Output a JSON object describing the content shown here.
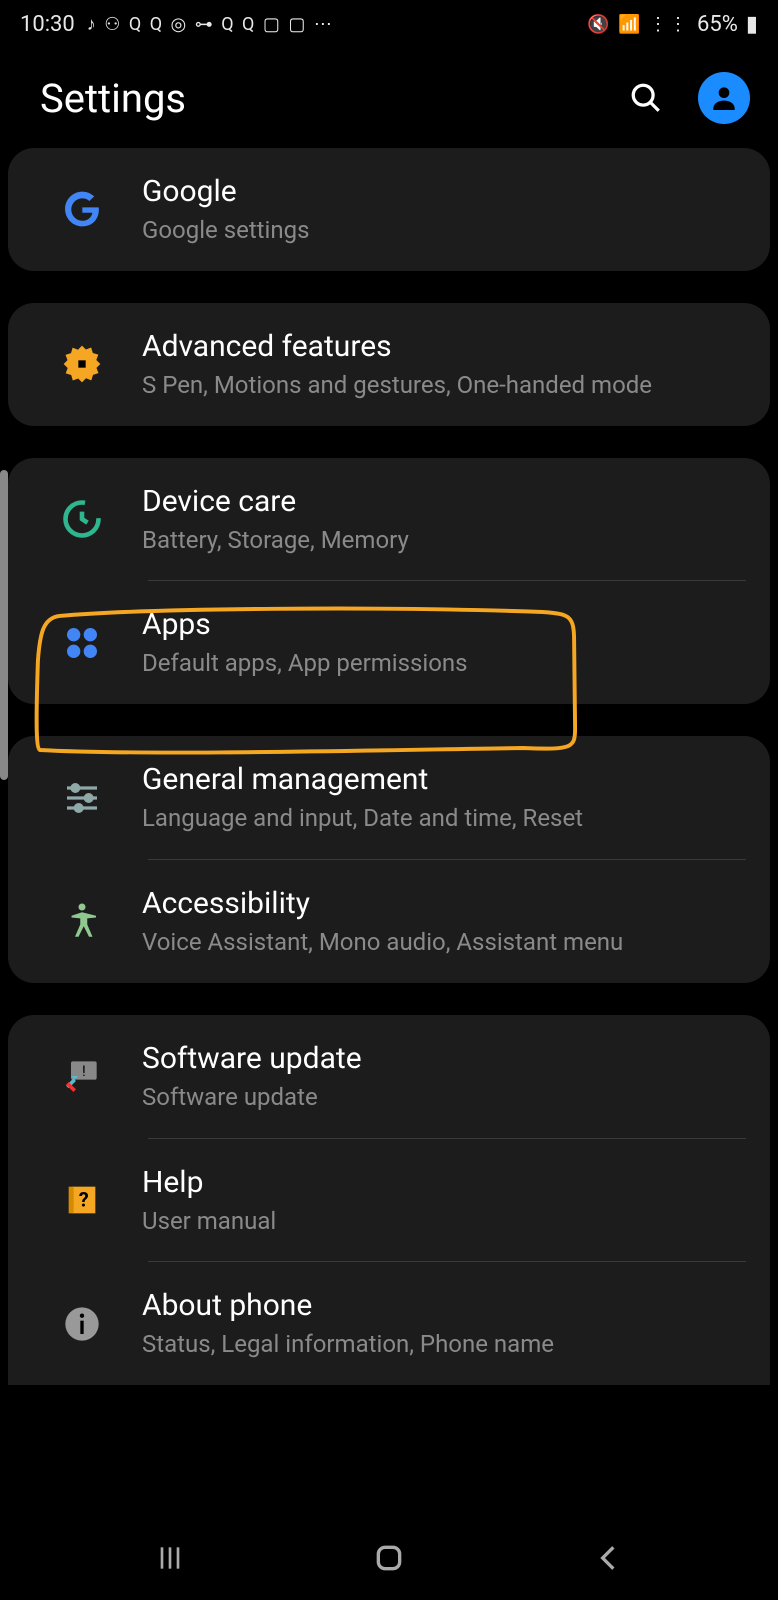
{
  "status": {
    "time": "10:30",
    "battery": "65%"
  },
  "header": {
    "title": "Settings"
  },
  "groups": [
    {
      "items": [
        {
          "id": "google",
          "title": "Google",
          "sub": "Google settings"
        }
      ]
    },
    {
      "items": [
        {
          "id": "advanced",
          "title": "Advanced features",
          "sub": "S Pen, Motions and gestures, One-handed mode"
        }
      ]
    },
    {
      "items": [
        {
          "id": "device-care",
          "title": "Device care",
          "sub": "Battery, Storage, Memory"
        },
        {
          "id": "apps",
          "title": "Apps",
          "sub": "Default apps, App permissions"
        }
      ]
    },
    {
      "items": [
        {
          "id": "general",
          "title": "General management",
          "sub": "Language and input, Date and time, Reset"
        },
        {
          "id": "accessibility",
          "title": "Accessibility",
          "sub": "Voice Assistant, Mono audio, Assistant menu"
        }
      ]
    },
    {
      "items": [
        {
          "id": "software-update",
          "title": "Software update",
          "sub": "Software update"
        },
        {
          "id": "help",
          "title": "Help",
          "sub": "User manual"
        },
        {
          "id": "about",
          "title": "About phone",
          "sub": "Status, Legal information, Phone name"
        }
      ]
    }
  ]
}
